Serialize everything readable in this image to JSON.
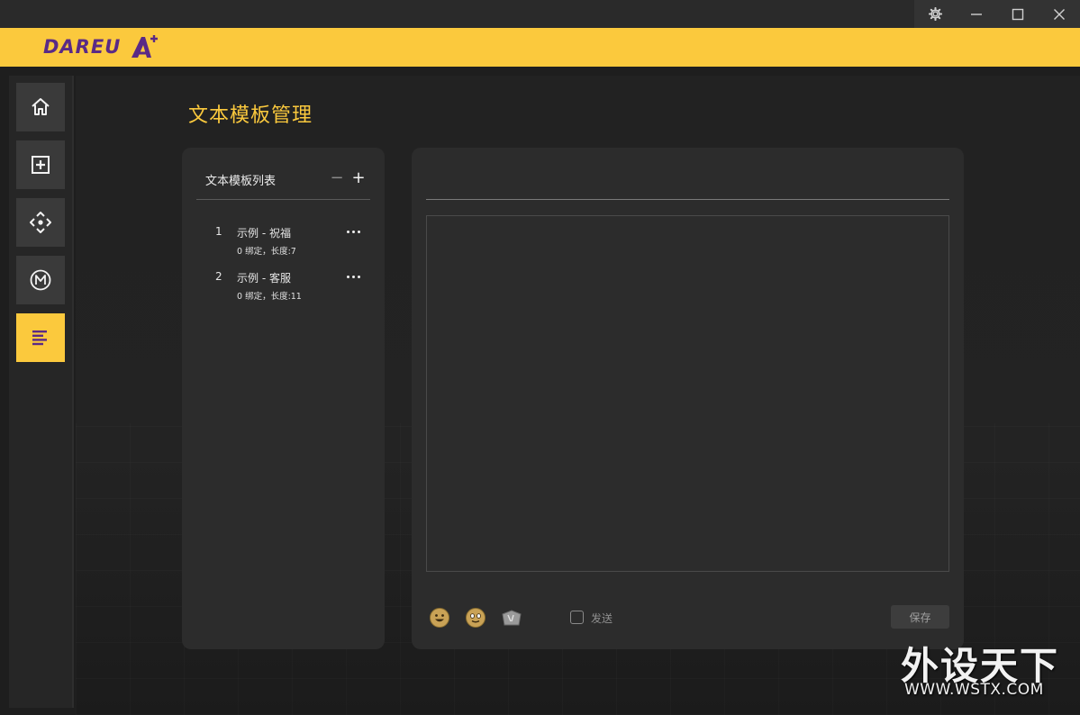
{
  "brand": {
    "name": "DAREU",
    "accent_color": "#fbc93d",
    "logo_color": "#5a2a86"
  },
  "window_controls": [
    {
      "name": "settings",
      "icon": "gear-icon"
    },
    {
      "name": "minimize",
      "icon": "minimize-icon"
    },
    {
      "name": "maximize",
      "icon": "maximize-icon"
    },
    {
      "name": "close",
      "icon": "close-icon"
    }
  ],
  "sidebar": {
    "items": [
      {
        "id": "home",
        "icon": "home-icon",
        "active": false
      },
      {
        "id": "add",
        "icon": "add-box-icon",
        "active": false
      },
      {
        "id": "move",
        "icon": "move-arrows-icon",
        "active": false
      },
      {
        "id": "macro",
        "icon": "macro-m-icon",
        "active": false
      },
      {
        "id": "text-template",
        "icon": "text-lines-icon",
        "active": true
      }
    ]
  },
  "page": {
    "title": "文本模板管理"
  },
  "template_list": {
    "title": "文本模板列表",
    "remove_symbol": "−",
    "add_symbol": "+",
    "items": [
      {
        "index": "1",
        "name": "示例 - 祝福",
        "meta": "0 绑定，长度:7"
      },
      {
        "index": "2",
        "name": "示例 - 客服",
        "meta": "0 绑定，长度:11"
      }
    ]
  },
  "editor": {
    "title_value": "",
    "body_value": "",
    "toolbar_icons": [
      "smiley-emoji-icon",
      "face-emoji-icon",
      "symbol-emoji-icon"
    ],
    "send_label": "发送",
    "send_checked": false,
    "save_label": "保存"
  },
  "watermark": {
    "big": "外设天下",
    "small": "WWW.WSTX.COM"
  }
}
